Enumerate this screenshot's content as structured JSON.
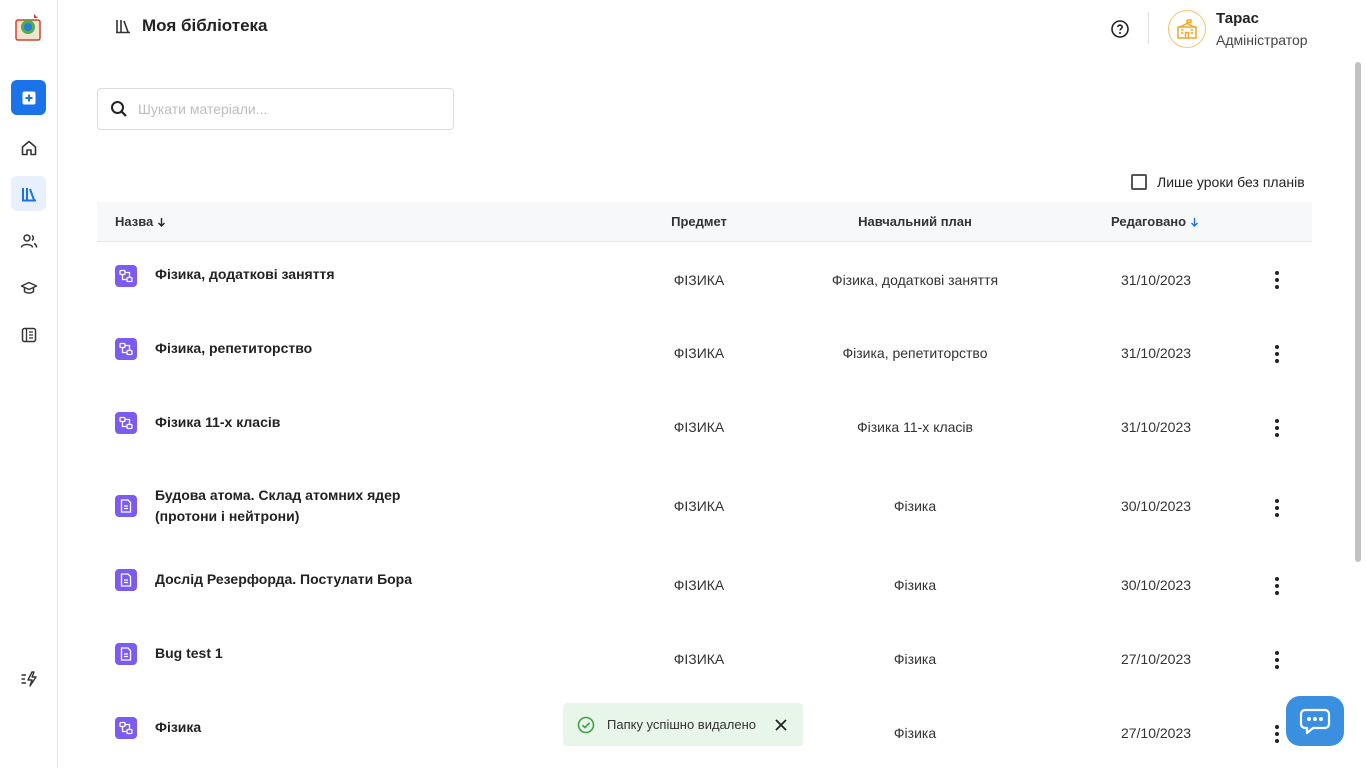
{
  "header": {
    "title": "Моя бібліотека"
  },
  "user": {
    "name": "Тарас",
    "role": "Адміністратор"
  },
  "search": {
    "placeholder": "Шукати матеріали..."
  },
  "filter": {
    "label": "Лише уроки без планів",
    "checked": false
  },
  "table": {
    "columns": {
      "name": "Назва",
      "subject": "Предмет",
      "plan": "Навчальний план",
      "edited": "Редаговано"
    },
    "rows": [
      {
        "type": "plan",
        "name": "Фізика, додаткові заняття",
        "subject": "ФІЗИКА",
        "plan": "Фізика, додаткові заняття",
        "edited": "31/10/2023"
      },
      {
        "type": "plan",
        "name": "Фізика, репетиторство",
        "subject": "ФІЗИКА",
        "plan": "Фізика, репетиторство",
        "edited": "31/10/2023"
      },
      {
        "type": "plan",
        "name": "Фізика 11-х класів",
        "subject": "ФІЗИКА",
        "plan": "Фізика 11-х класів",
        "edited": "31/10/2023"
      },
      {
        "type": "lesson",
        "name": "Будова атома. Склад атомних ядер (протони і нейтрони)",
        "subject": "ФІЗИКА",
        "plan": "Фізика",
        "edited": "30/10/2023"
      },
      {
        "type": "lesson",
        "name": "Дослід Резерфорда. Постулати Бора",
        "subject": "ФІЗИКА",
        "plan": "Фізика",
        "edited": "30/10/2023"
      },
      {
        "type": "lesson",
        "name": "Bug test 1",
        "subject": "ФІЗИКА",
        "plan": "Фізика",
        "edited": "27/10/2023"
      },
      {
        "type": "plan",
        "name": "Фізика",
        "subject": "",
        "plan": "Фізика",
        "edited": "27/10/2023"
      }
    ]
  },
  "toast": {
    "message": "Папку успішно видалено"
  },
  "colors": {
    "primary": "#1a73e8",
    "icon_purple": "#7c5cf0",
    "toast_bg": "#e8f5e9",
    "chat": "#3b8fe0"
  }
}
